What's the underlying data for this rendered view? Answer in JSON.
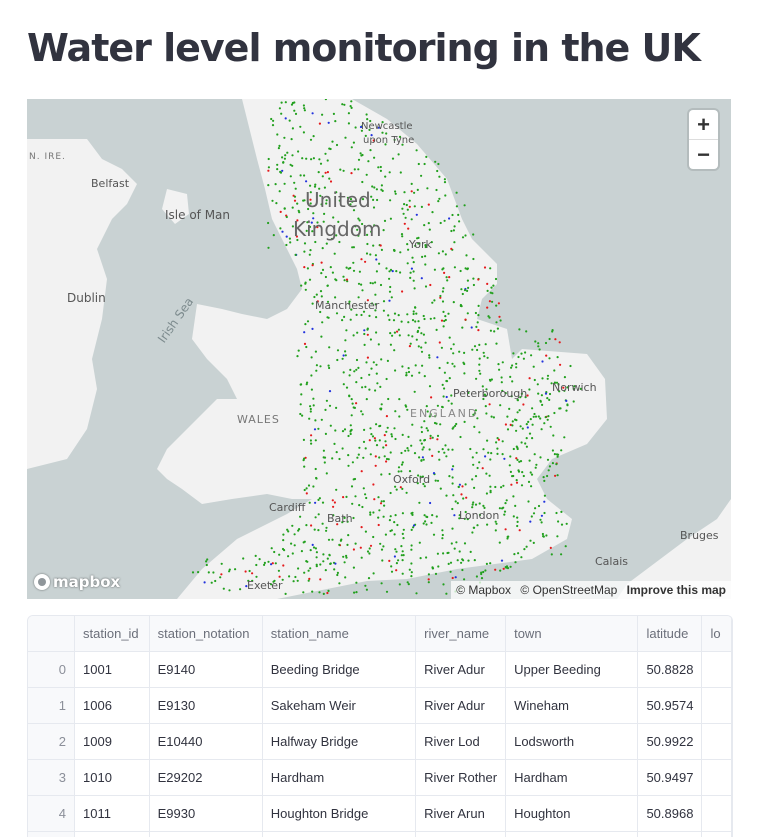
{
  "page": {
    "title": "Water level monitoring in the UK"
  },
  "map": {
    "zoom_in": "+",
    "zoom_out": "−",
    "logo_text": "mapbox",
    "attribution": {
      "mapbox": "© Mapbox",
      "osm": "© OpenStreetMap",
      "improve": "Improve this map"
    },
    "labels": {
      "uk_line1": "United",
      "uk_line2": "Kingdom",
      "newcastle1": "Newcastle",
      "newcastle2": "upon Tyne",
      "nire": "N. IRE.",
      "belfast": "Belfast",
      "isle_of_man": "Isle of Man",
      "york": "York",
      "dublin": "Dublin",
      "irish_sea": "Irish Sea",
      "manchester": "Manchester",
      "norwich": "Norwich",
      "peterborough": "Peterborough",
      "wales": "WALES",
      "england": "ENGLAND",
      "cardiff": "Cardiff",
      "oxford": "Oxford",
      "bath": "Bath",
      "london": "London",
      "bruges": "Bruges",
      "calais": "Calais",
      "exeter": "Exeter"
    },
    "colors": {
      "water": "#c9d2d3",
      "land": "#f2f2f2",
      "normal": "#22a01e",
      "high": "#e41a1c",
      "low": "#2233dd"
    }
  },
  "table": {
    "columns": [
      "",
      "station_id",
      "station_notation",
      "station_name",
      "river_name",
      "town",
      "latitude",
      "lo"
    ],
    "rows": [
      [
        "0",
        "1001",
        "E9140",
        "Beeding Bridge",
        "River Adur",
        "Upper Beeding",
        "50.8828"
      ],
      [
        "1",
        "1006",
        "E9130",
        "Sakeham Weir",
        "River Adur",
        "Wineham",
        "50.9574"
      ],
      [
        "2",
        "1009",
        "E10440",
        "Halfway Bridge",
        "River Lod",
        "Lodsworth",
        "50.9922"
      ],
      [
        "3",
        "1010",
        "E29202",
        "Hardham",
        "River Rother",
        "Hardham",
        "50.9497"
      ],
      [
        "4",
        "1011",
        "E9930",
        "Houghton Bridge",
        "River Arun",
        "Houghton",
        "50.8968"
      ],
      [
        "",
        "",
        "",
        "",
        "",
        "",
        ""
      ]
    ]
  }
}
